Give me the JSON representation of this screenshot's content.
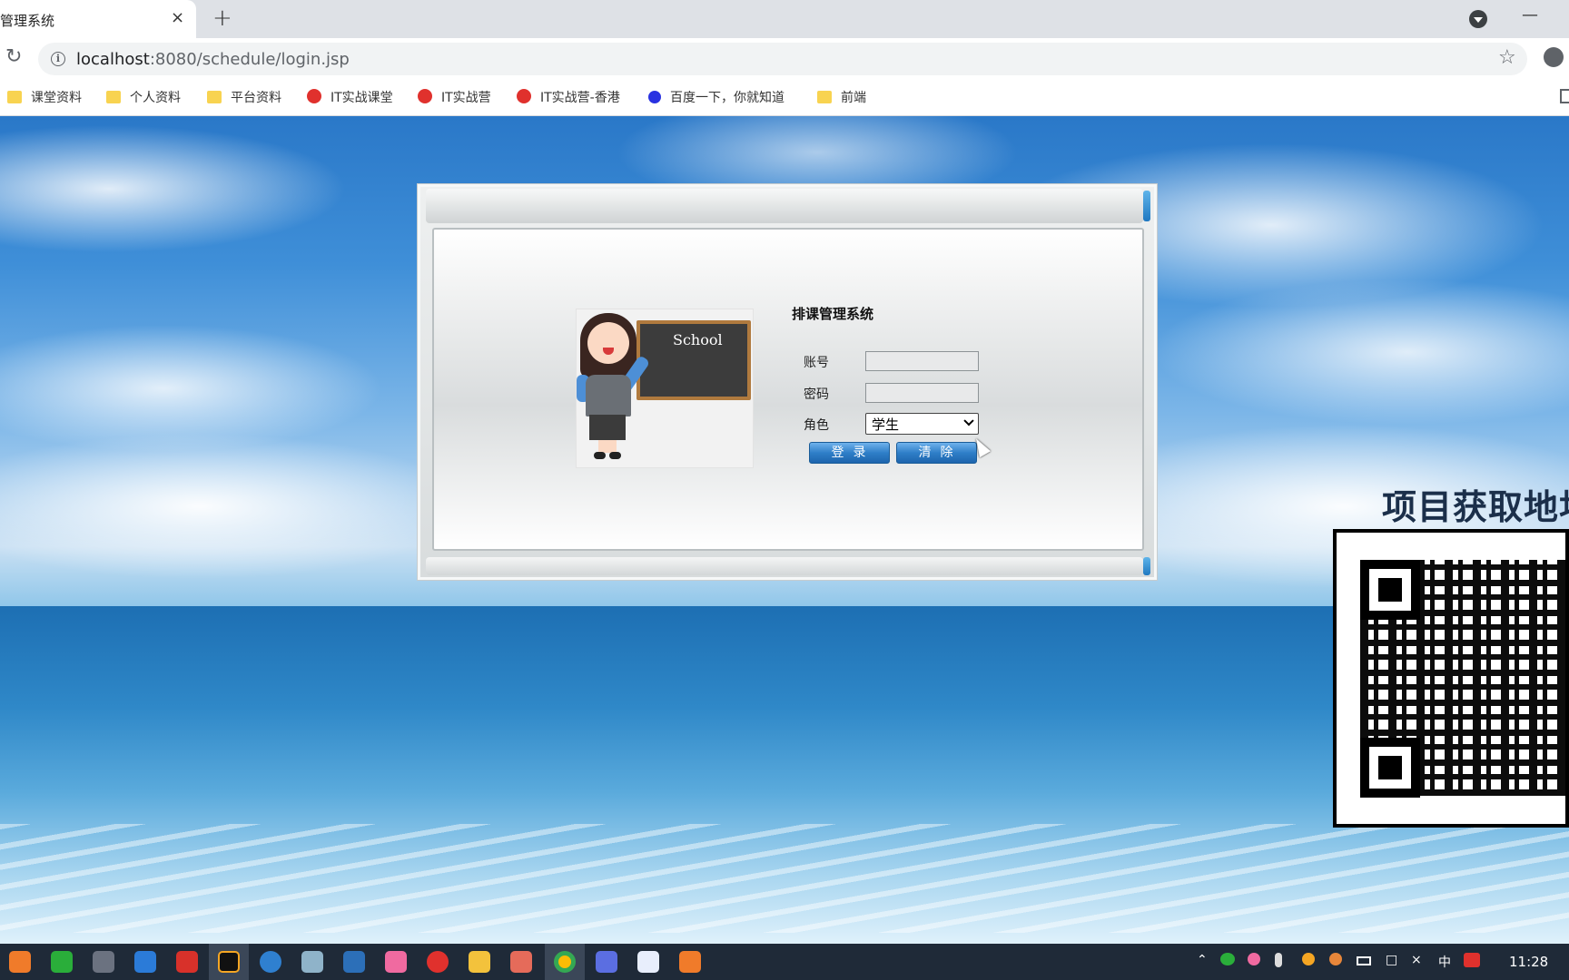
{
  "browser": {
    "tab_title": "管理系统",
    "tab_close": "×",
    "new_tab": "+",
    "url_host": "localhost",
    "url_rest": ":8080/schedule/login.jsp",
    "bookmarks": [
      "课堂资料",
      "个人资料",
      "平台资料",
      "IT实战课堂",
      "IT实战营",
      "IT实战营-香港",
      "百度一下，你就知道",
      "前端"
    ]
  },
  "login": {
    "system_title": "排课管理系统",
    "board_text": "School",
    "account_label": "账号",
    "account_value": "",
    "password_label": "密码",
    "password_value": "",
    "role_label": "角色",
    "role_selected": "学生",
    "login_button": "登录",
    "clear_button": "清除"
  },
  "promo": {
    "text": "项目获取地址"
  },
  "taskbar": {
    "clock": "11:28",
    "ime": "中"
  },
  "colors": {
    "button_blue": "#2f7fc8",
    "accent_blue": "#1f78c1"
  }
}
